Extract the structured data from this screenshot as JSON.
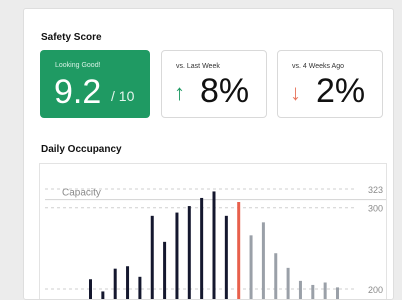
{
  "safety": {
    "title": "Safety Score",
    "score_caption": "Looking Good!",
    "score_value": "9.2",
    "score_max": "/ 10",
    "week": {
      "caption": "vs. Last Week",
      "arrow": "↑",
      "value": "8%",
      "color": "#1f9a63"
    },
    "four_weeks": {
      "caption": "vs. 4 Weeks Ago",
      "arrow": "↓",
      "value": "2%",
      "color": "#e8765e"
    }
  },
  "occupancy": {
    "title": "Daily Occupancy"
  },
  "chart_data": {
    "type": "bar",
    "yticks": [
      323,
      300,
      200
    ],
    "ylim": [
      170,
      323
    ],
    "capacity_label": "Capacity",
    "capacity_value": 310,
    "values": [
      212,
      197,
      225,
      228,
      215,
      290,
      258,
      294,
      302,
      312,
      320,
      290,
      307,
      266,
      282,
      244,
      226,
      210,
      205,
      208,
      202
    ],
    "colors": [
      "#14172e",
      "#14172e",
      "#14172e",
      "#14172e",
      "#14172e",
      "#14172e",
      "#14172e",
      "#14172e",
      "#14172e",
      "#14172e",
      "#14172e",
      "#14172e",
      "#e8604c",
      "#9aa0a8",
      "#9aa0a8",
      "#9aa0a8",
      "#9aa0a8",
      "#9aa0a8",
      "#9aa0a8",
      "#9aa0a8",
      "#9aa0a8"
    ]
  }
}
